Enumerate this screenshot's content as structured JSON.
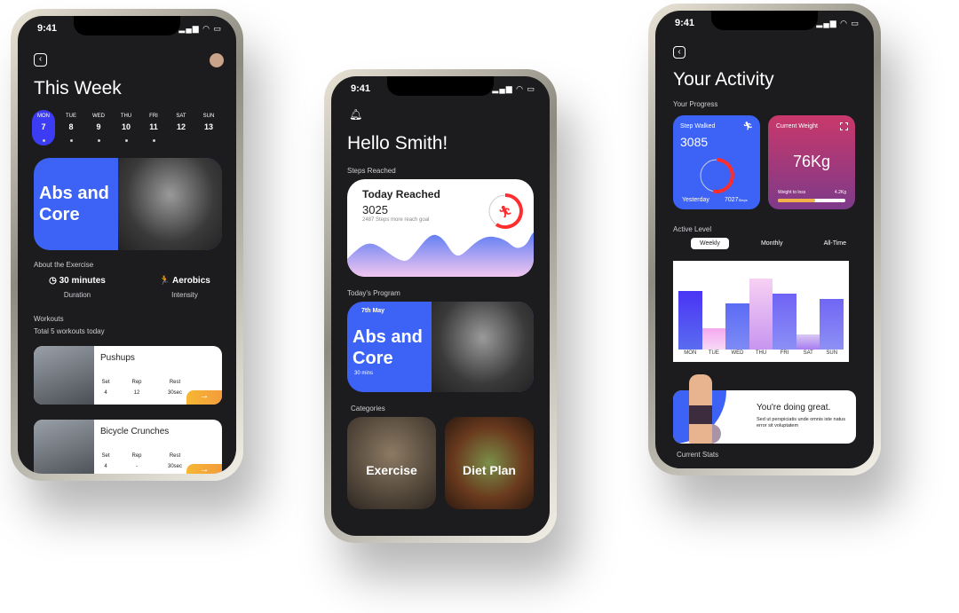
{
  "status": {
    "time": "9:41"
  },
  "left": {
    "title": "This Week",
    "days": [
      {
        "d": "MON",
        "n": "7"
      },
      {
        "d": "TUE",
        "n": "8"
      },
      {
        "d": "WED",
        "n": "9"
      },
      {
        "d": "THU",
        "n": "10"
      },
      {
        "d": "FRI",
        "n": "11"
      },
      {
        "d": "SAT",
        "n": "12"
      },
      {
        "d": "SUN",
        "n": "13"
      }
    ],
    "hero": "Abs and Core",
    "about": "About the Exercise",
    "duration": {
      "value": "30 minutes",
      "label": "Duration"
    },
    "intensity": {
      "value": "Aerobics",
      "label": "Intensity"
    },
    "workouts": "Workouts",
    "total": "Total 5 workouts today",
    "cols": {
      "set": "Set",
      "rep": "Rep",
      "rest": "Rest"
    },
    "items": [
      {
        "name": "Pushups",
        "set": "4",
        "rep": "12",
        "rest": "30sec"
      },
      {
        "name": "Bicycle Crunches",
        "set": "4",
        "rep": "-",
        "rest": "30sec"
      }
    ]
  },
  "middle": {
    "title": "Hello Smith!",
    "steps_label": "Steps Reached",
    "reached_title": "Today Reached",
    "reached_value": "3025",
    "reached_sub": "2487 Steps more reach goal",
    "program_label": "Today's Program",
    "program_date": "7th May",
    "program_title": "Abs and Core",
    "program_dur": "30 mins",
    "categories_label": "Categories",
    "categories": [
      "Exercise",
      "Diet Plan"
    ]
  },
  "right": {
    "title": "Your Activity",
    "progress": "Your Progress",
    "steps": {
      "title": "Step Walked",
      "value": "3085",
      "yesterday": "Yesterday",
      "yvalue": "7027",
      "yunit": "Steps",
      "progress": 0.55
    },
    "weight": {
      "title": "Current Weight",
      "value": "76Kg",
      "loss_label": "Weight to loss",
      "loss": "4.2Kg",
      "progress": 0.55
    },
    "active": "Active Level",
    "tabs": [
      "Weekly",
      "Monthly",
      "All-Time"
    ],
    "chart": {
      "days": [
        "MON",
        "TUE",
        "WED",
        "THU",
        "FRI",
        "SAT",
        "SUN"
      ],
      "levels": [
        0.7,
        0.26,
        0.55,
        0.85,
        0.67,
        0.18,
        0.61
      ]
    },
    "great_title": "You're doing great.",
    "great_sub": "Sed ut perspiciatis unde omnis iste natus error sit voluptatem",
    "current": "Current Stats"
  },
  "colors": {
    "blue": "#3c63f5",
    "red": "#ff2d2d",
    "orange": "#f7b733",
    "pink": "#c2366e"
  }
}
